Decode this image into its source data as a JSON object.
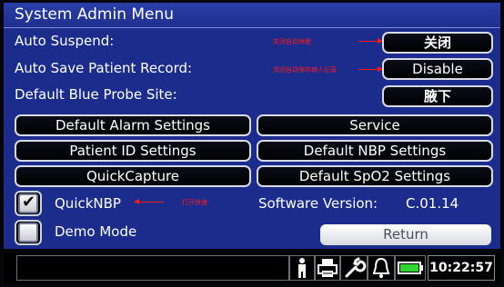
{
  "window": {
    "title": "System Admin Menu"
  },
  "settings": {
    "auto_suspend": {
      "label": "Auto Suspend:",
      "value": "关闭",
      "annotation": "关闭自动休眠"
    },
    "auto_save": {
      "label": "Auto Save Patient Record:",
      "value": "Disable",
      "annotation": "关闭自动保存病人记录"
    },
    "probe_site": {
      "label": "Default Blue Probe Site:",
      "value": "腋下"
    }
  },
  "buttons": {
    "alarm": "Default Alarm Settings",
    "service": "Service",
    "patient_id": "Patient ID Settings",
    "nbp": "Default NBP Settings",
    "quickcapture": "QuickCapture",
    "spo2": "Default SpO2 Settings",
    "return": "Return"
  },
  "options": {
    "quicknbp": {
      "label": "QuickNBP",
      "checked": true,
      "annotation": "打开快速"
    },
    "demo_mode": {
      "label": "Demo Mode",
      "checked": false
    }
  },
  "software_version": {
    "label": "Software Version:",
    "value": "C.01.14"
  },
  "status_bar": {
    "icons": [
      "person-icon",
      "printer-icon",
      "wrench-icon",
      "bell-icon",
      "battery-icon"
    ],
    "battery_level": 1.0,
    "time": "10:22:57"
  }
}
